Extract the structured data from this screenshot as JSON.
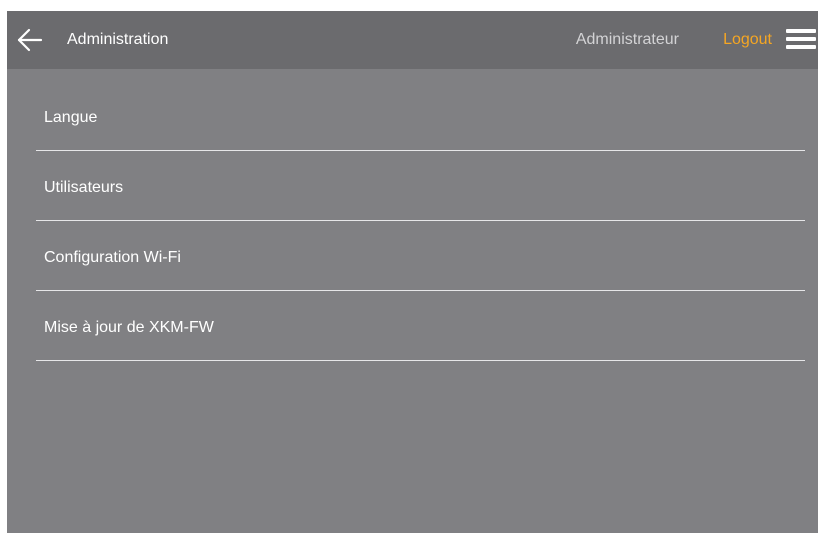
{
  "header": {
    "back_icon": "arrow-left-icon",
    "title": "Administration",
    "user_name": "Administrateur",
    "logout_label": "Logout",
    "menu_icon": "hamburger-menu-icon",
    "accent_color": "#f5a623"
  },
  "menu": {
    "items": [
      {
        "label": "Langue"
      },
      {
        "label": "Utilisateurs"
      },
      {
        "label": "Configuration Wi-Fi"
      },
      {
        "label": "Mise à jour de XKM-FW"
      }
    ]
  }
}
